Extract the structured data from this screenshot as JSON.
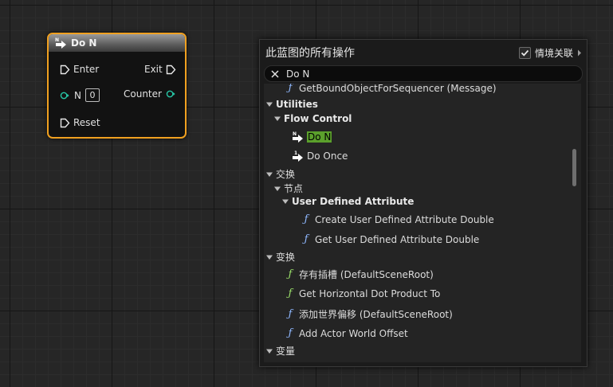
{
  "node": {
    "title": "Do N",
    "pins": {
      "enter": "Enter",
      "exit": "Exit",
      "n": "N",
      "n_value": "0",
      "counter": "Counter",
      "reset": "Reset"
    }
  },
  "menu": {
    "title": "此蓝图的所有操作",
    "context_label": "情境关联",
    "context_checked": true,
    "search_value": "Do N",
    "items": [
      {
        "label": "GetBoundObjectForSequencer (Message)"
      },
      {
        "label": "Utilities"
      },
      {
        "label": "Flow Control"
      },
      {
        "label": "Do N"
      },
      {
        "label": "Do Once"
      },
      {
        "label": "交换"
      },
      {
        "label": "节点"
      },
      {
        "label": "User Defined Attribute"
      },
      {
        "label": "Create User Defined Attribute Double"
      },
      {
        "label": "Get User Defined Attribute Double"
      },
      {
        "label": "变换"
      },
      {
        "label": "存有插槽 (DefaultSceneRoot)"
      },
      {
        "label": "Get Horizontal Dot Product To"
      },
      {
        "label": "添加世界偏移 (DefaultSceneRoot)"
      },
      {
        "label": "Add Actor World Offset"
      },
      {
        "label": "变量"
      }
    ]
  },
  "colors": {
    "node_border": "#f0a020",
    "highlight": "#5ba02c",
    "int_pin": "#27c9a8",
    "function_blue": "#8fb8ff",
    "function_green": "#9be06a"
  }
}
